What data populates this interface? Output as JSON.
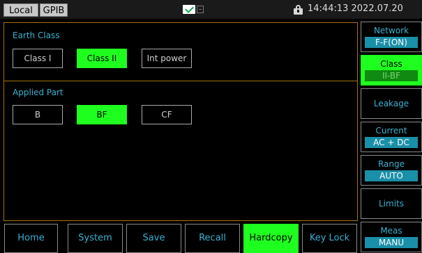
{
  "status": {
    "local_label": "Local",
    "gpib_label": "GPIB",
    "icons": [
      "mail-check-icon",
      "lock-icon"
    ],
    "datetime": "14:44:13 2022.07.20"
  },
  "earth_class": {
    "label": "Earth Class",
    "options": [
      "Class I",
      "Class II",
      "Int power"
    ],
    "selected": "Class II"
  },
  "applied_part": {
    "label": "Applied Part",
    "options": [
      "B",
      "BF",
      "CF"
    ],
    "selected": "BF"
  },
  "soft_keys": [
    {
      "label": "Network",
      "value": "F-F(ON)"
    },
    {
      "label": "Class",
      "value": "II-BF"
    },
    {
      "label": "Leakage"
    },
    {
      "label": "Current",
      "value": "AC + DC"
    },
    {
      "label": "Range",
      "value": "AUTO"
    },
    {
      "label": "Limits"
    },
    {
      "label": "Meas",
      "value": "MANU"
    }
  ],
  "bottom_keys": [
    "Home",
    "System",
    "Save",
    "Recall",
    "Hardcopy",
    "Key Lock"
  ],
  "colors": {
    "selected_green": "#1fff1f",
    "label_cyan": "#3ab0d0",
    "divider_orange": "#a8720f",
    "value_teal": "#1a8fa8"
  }
}
